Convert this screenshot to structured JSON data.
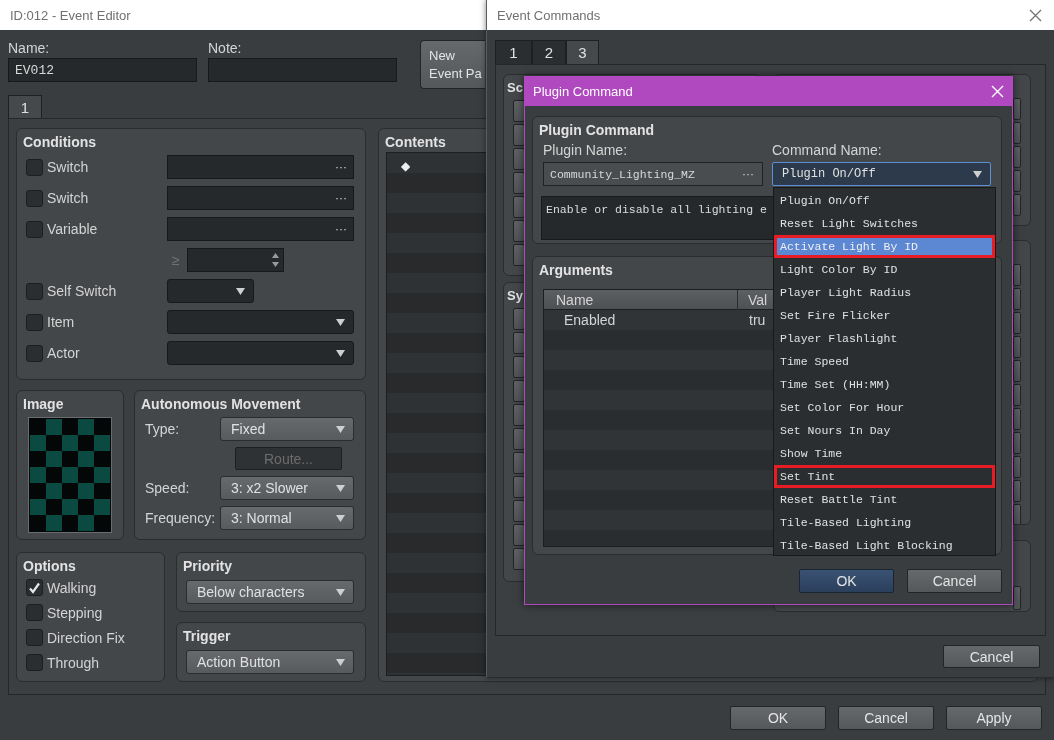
{
  "event_editor": {
    "window": {
      "title": "ID:012 - Event Editor"
    },
    "name": {
      "label": "Name:",
      "value": "EV012"
    },
    "note": {
      "label": "Note:"
    },
    "new_page_button": {
      "label": "New\nEvent Pa"
    },
    "page_tabs": [
      {
        "label": "1",
        "selected": true
      }
    ],
    "conditions": {
      "title": "Conditions",
      "rows": [
        {
          "kind": "picker",
          "label": "Switch",
          "checked": false,
          "button": "···"
        },
        {
          "kind": "picker",
          "label": "Switch",
          "checked": false,
          "button": "···"
        },
        {
          "kind": "picker",
          "label": "Variable",
          "checked": false,
          "button": "···"
        },
        {
          "kind": "compare",
          "operator": "≥"
        },
        {
          "kind": "short-select",
          "label": "Self Switch",
          "checked": false
        },
        {
          "kind": "select",
          "label": "Item",
          "checked": false
        },
        {
          "kind": "select",
          "label": "Actor",
          "checked": false
        }
      ]
    },
    "image": {
      "title": "Image"
    },
    "movement": {
      "title": "Autonomous Movement",
      "type": {
        "label": "Type:",
        "value": "Fixed"
      },
      "route_button": {
        "label": "Route...",
        "disabled": true
      },
      "speed": {
        "label": "Speed:",
        "value": "3: x2 Slower"
      },
      "frequency": {
        "label": "Frequency:",
        "value": "3: Normal"
      }
    },
    "options": {
      "title": "Options",
      "items": [
        {
          "label": "Walking",
          "checked": true
        },
        {
          "label": "Stepping",
          "checked": false
        },
        {
          "label": "Direction Fix",
          "checked": false
        },
        {
          "label": "Through",
          "checked": false
        }
      ]
    },
    "priority": {
      "title": "Priority",
      "value": "Below characters"
    },
    "trigger": {
      "title": "Trigger",
      "value": "Action Button"
    },
    "contents": {
      "title": "Contents",
      "rows": [
        {
          "marker": "◆"
        }
      ]
    },
    "buttons": [
      {
        "label": "OK"
      },
      {
        "label": "Cancel"
      },
      {
        "label": "Apply"
      }
    ]
  },
  "event_commands": {
    "window": {
      "title": "Event Commands"
    },
    "tabs": [
      {
        "label": "1",
        "selected": false
      },
      {
        "label": "2",
        "selected": false
      },
      {
        "label": "3",
        "selected": true
      }
    ],
    "left_groups": [
      {
        "title": "Sc"
      },
      {
        "title": "Sy"
      }
    ],
    "buttons": [
      {
        "label": "Cancel"
      }
    ]
  },
  "plugin_command": {
    "window": {
      "title": "Plugin Command"
    },
    "group_title": "Plugin Command",
    "plugin_name": {
      "label": "Plugin Name:",
      "value": "Community_Lighting_MZ",
      "button": "···"
    },
    "command_name": {
      "label": "Command Name:",
      "value": "Plugin On/Off",
      "focused": true
    },
    "description": "Enable or disable all lighting e",
    "arguments": {
      "title": "Arguments",
      "columns": [
        "Name",
        "Val"
      ],
      "rows": [
        [
          "Enabled",
          "tru"
        ]
      ]
    },
    "buttons": [
      {
        "label": "OK",
        "default": true
      },
      {
        "label": "Cancel",
        "default": false
      }
    ],
    "dropdown": {
      "items": [
        {
          "label": "Plugin On/Off",
          "selected": false,
          "outlined": false
        },
        {
          "label": "Reset Light Switches",
          "selected": false,
          "outlined": false
        },
        {
          "label": "Activate Light By ID",
          "selected": true,
          "outlined": true
        },
        {
          "label": "Light Color By ID",
          "selected": false,
          "outlined": false
        },
        {
          "label": "Player Light Radius",
          "selected": false,
          "outlined": false
        },
        {
          "label": "Set Fire Flicker",
          "selected": false,
          "outlined": false
        },
        {
          "label": "Player Flashlight",
          "selected": false,
          "outlined": false
        },
        {
          "label": "Time Speed",
          "selected": false,
          "outlined": false
        },
        {
          "label": "Time Set (HH:MM)",
          "selected": false,
          "outlined": false
        },
        {
          "label": "Set Color For Hour",
          "selected": false,
          "outlined": false
        },
        {
          "label": "Set Nours In Day",
          "selected": false,
          "outlined": false
        },
        {
          "label": "Show Time",
          "selected": false,
          "outlined": false
        },
        {
          "label": "Set Tint",
          "selected": false,
          "outlined": true
        },
        {
          "label": "Reset Battle Tint",
          "selected": false,
          "outlined": false
        },
        {
          "label": "Tile-Based Lighting",
          "selected": false,
          "outlined": false
        },
        {
          "label": "Tile-Based Light Blocking",
          "selected": false,
          "outlined": false
        }
      ]
    }
  }
}
